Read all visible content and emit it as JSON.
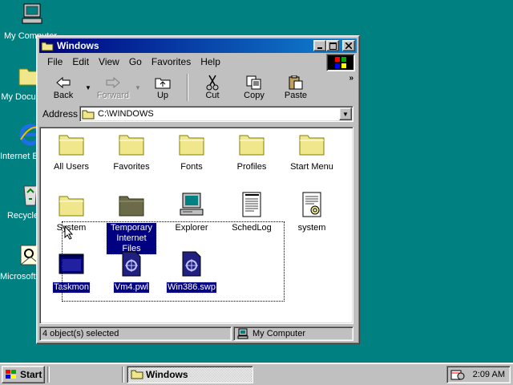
{
  "desktop": {
    "icons": [
      {
        "label": "My Computer"
      },
      {
        "label": "My Documents"
      },
      {
        "label": "Internet Explorer"
      },
      {
        "label": "Recycle Bin"
      },
      {
        "label": "Microsoft Outlook"
      }
    ]
  },
  "window": {
    "title": "Windows",
    "menu": [
      "File",
      "Edit",
      "View",
      "Go",
      "Favorites",
      "Help"
    ],
    "toolbar": {
      "back": "Back",
      "forward": "Forward",
      "up": "Up",
      "cut": "Cut",
      "copy": "Copy",
      "paste": "Paste",
      "more": "»"
    },
    "address": {
      "label": "Address",
      "value": "C:\\WINDOWS"
    },
    "items": [
      {
        "label": "All Users",
        "type": "folder",
        "selected": false
      },
      {
        "label": "Favorites",
        "type": "folder",
        "selected": false
      },
      {
        "label": "Fonts",
        "type": "folder",
        "selected": false
      },
      {
        "label": "Profiles",
        "type": "folder",
        "selected": false
      },
      {
        "label": "Start Menu",
        "type": "folder",
        "selected": false
      },
      {
        "label": "System",
        "type": "folder",
        "selected": false
      },
      {
        "label": "Temporary Internet Files",
        "type": "folder-special",
        "selected": true
      },
      {
        "label": "Explorer",
        "type": "application",
        "selected": false
      },
      {
        "label": "SchedLog",
        "type": "text-document",
        "selected": false
      },
      {
        "label": "system",
        "type": "settings-document",
        "selected": false
      },
      {
        "label": "Taskmon",
        "type": "application-window",
        "selected": true
      },
      {
        "label": "Vm4.pwl",
        "type": "system-file",
        "selected": true
      },
      {
        "label": "Win386.swp",
        "type": "system-file",
        "selected": true
      }
    ],
    "status": {
      "selection": "4 object(s) selected",
      "zone": "My Computer"
    }
  },
  "taskbar": {
    "start": "Start",
    "task": "Windows",
    "clock": "2:09 AM"
  },
  "colors": {
    "desktop": "#008080",
    "title_active": "#000080",
    "selection": "#000080",
    "folder": "#f0e68c"
  }
}
